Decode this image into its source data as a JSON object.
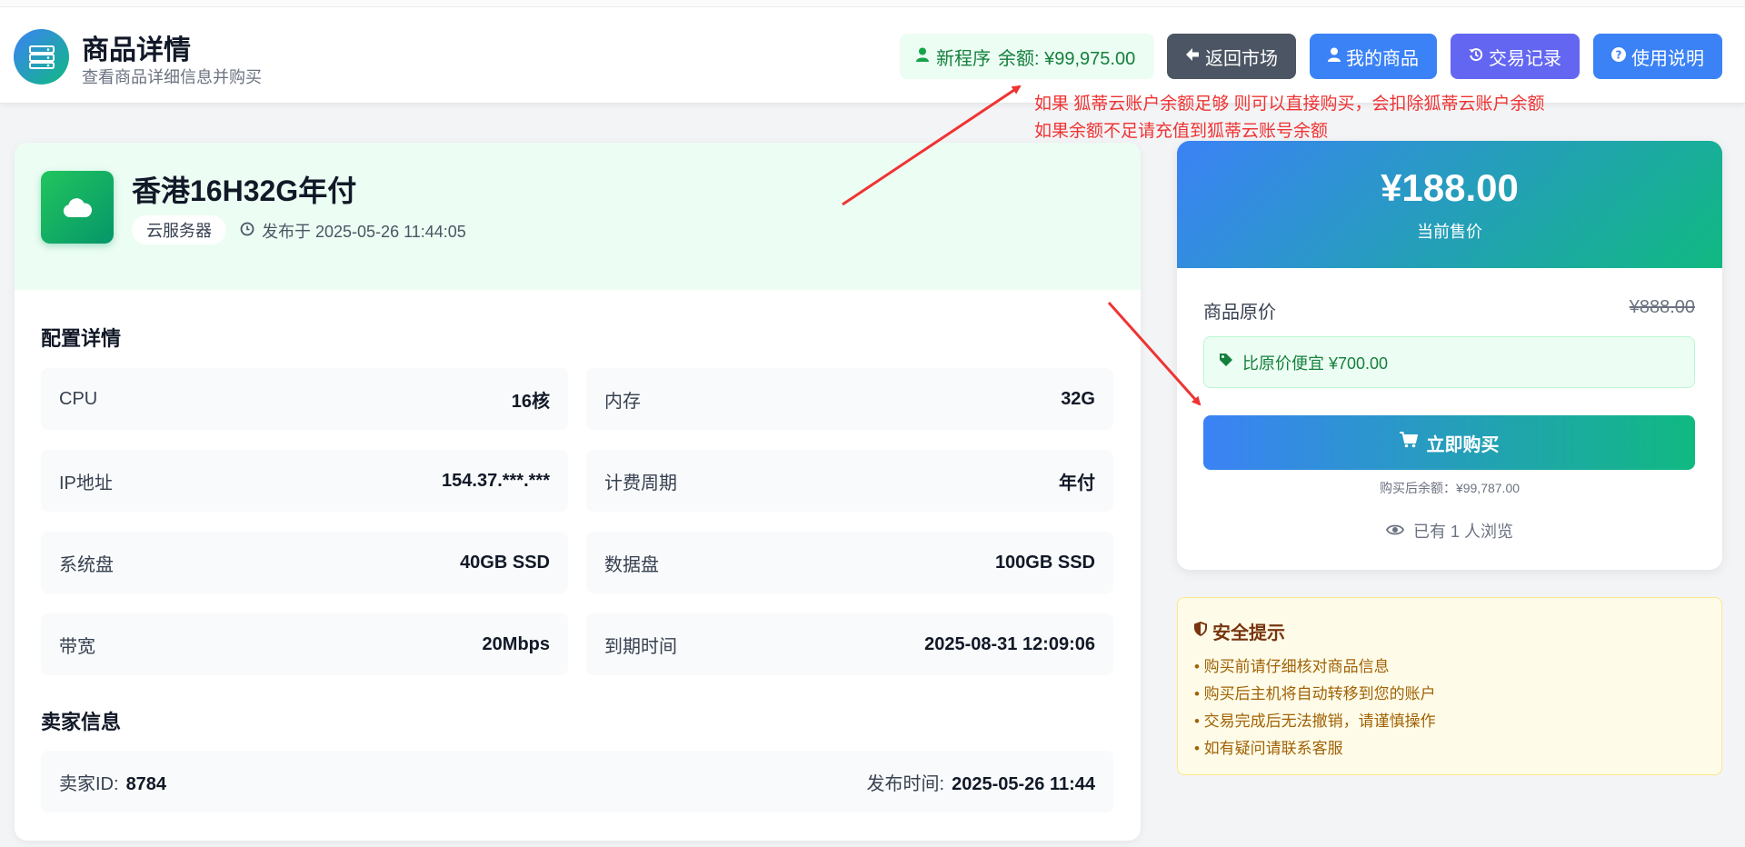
{
  "header": {
    "title": "商品详情",
    "subtitle": "查看商品详细信息并购买",
    "balance": {
      "prefix": "新程序",
      "label": "余额: ¥99,975.00"
    },
    "buttons": {
      "back": "返回市场",
      "mine": "我的商品",
      "trades": "交易记录",
      "help": "使用说明"
    }
  },
  "annotation": {
    "line1": "如果 狐蒂云账户余额足够 则可以直接购买，会扣除狐蒂云账户余额",
    "line2": "如果余额不足请充值到狐蒂云账号余额"
  },
  "product": {
    "title": "香港16H32G年付",
    "tag": "云服务器",
    "published": "发布于 2025-05-26 11:44:05"
  },
  "config": {
    "heading": "配置详情",
    "items": [
      {
        "key": "CPU",
        "value": "16核"
      },
      {
        "key": "内存",
        "value": "32G"
      },
      {
        "key": "IP地址",
        "value": "154.37.***.***"
      },
      {
        "key": "计费周期",
        "value": "年付"
      },
      {
        "key": "系统盘",
        "value": "40GB SSD"
      },
      {
        "key": "数据盘",
        "value": "100GB SSD"
      },
      {
        "key": "带宽",
        "value": "20Mbps"
      },
      {
        "key": "到期时间",
        "value": "2025-08-31 12:09:06"
      }
    ]
  },
  "seller": {
    "heading": "卖家信息",
    "id_label": "卖家ID:",
    "id_value": "8784",
    "time_label": "发布时间:",
    "time_value": "2025-05-26 11:44"
  },
  "price": {
    "current": "¥188.00",
    "current_label": "当前售价",
    "original_label": "商品原价",
    "original_value": "¥888.00",
    "discount": "比原价便宜 ¥700.00",
    "buy_label": "立即购买",
    "after_balance": "购买后余额：¥99,787.00",
    "views": "已有 1 人浏览"
  },
  "safety": {
    "title": "安全提示",
    "items": [
      "• 购买前请仔细核对商品信息",
      "• 购买后主机将自动转移到您的账户",
      "• 交易完成后无法撤销，请谨慎操作",
      "• 如有疑问请联系客服"
    ]
  },
  "colors": {
    "accent_blue": "#3b82f6",
    "accent_green": "#10b981",
    "annotation_red": "#ef3333"
  }
}
